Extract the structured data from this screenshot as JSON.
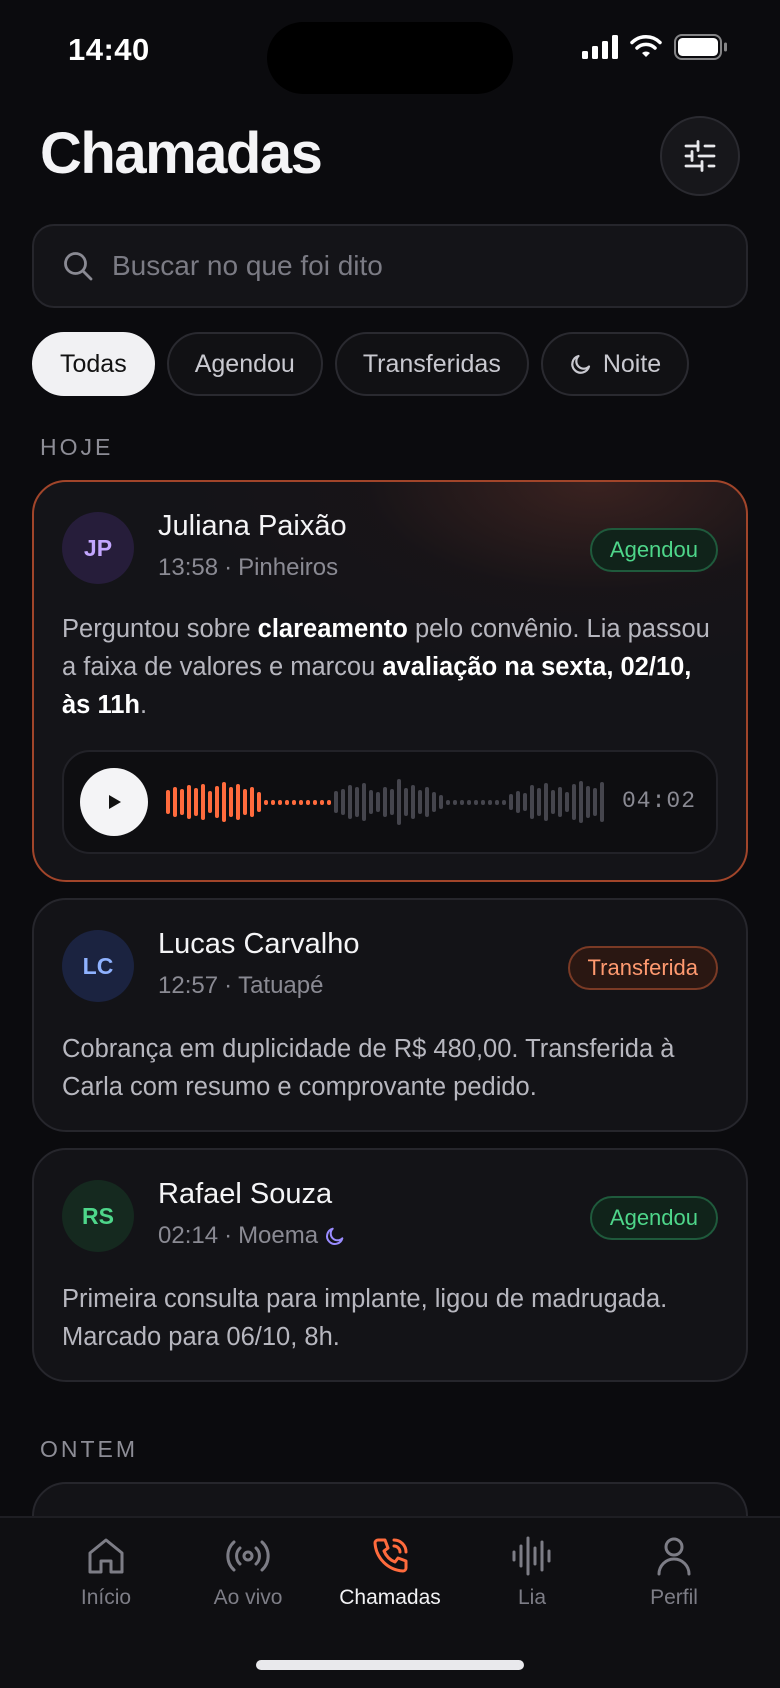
{
  "status": {
    "time": "14:40"
  },
  "header": {
    "title": "Chamadas",
    "filter_icon": "sliders-icon"
  },
  "search": {
    "placeholder": "Buscar no que foi dito",
    "value": ""
  },
  "chips": [
    {
      "label": "Todas",
      "active": true
    },
    {
      "label": "Agendou",
      "active": false
    },
    {
      "label": "Transferidas",
      "active": false
    },
    {
      "label": "Noite",
      "icon": "moon-icon",
      "active": false
    }
  ],
  "sections": {
    "today": "HOJE",
    "yesterday": "ONTEM"
  },
  "calls": [
    {
      "initials": "JP",
      "name": "Juliana Paixão",
      "time": "13:58",
      "place": "Pinheiros",
      "badge": "Agendou",
      "badge_color": "#4ed68a",
      "summary": {
        "t1": "Perguntou sobre ",
        "b1": "clareamento",
        "t2": " pelo convênio. Lia passou a faixa de valores e marcou ",
        "b2": "avaliação na sexta, 02/10, às 11h",
        "t3": "."
      },
      "audio": {
        "duration": "04:02",
        "played_fraction": 0.27,
        "accent": "#ff6b3d"
      }
    },
    {
      "initials": "LC",
      "name": "Lucas Carvalho",
      "time": "12:57",
      "place": "Tatuapé",
      "badge": "Transferida",
      "badge_color": "#ff9a70",
      "summary": "Cobrança em duplicidade de R$ 480,00. Transferida à Carla com resumo e comprovante pedido."
    },
    {
      "initials": "RS",
      "name": "Rafael Souza",
      "time": "02:14",
      "place": "Moema",
      "night": true,
      "badge": "Agendou",
      "badge_color": "#4ed68a",
      "summary": "Primeira consulta para implante, ligou de madrugada. Marcado para 06/10, 8h."
    }
  ],
  "tabs": [
    {
      "label": "Início",
      "icon": "home-icon",
      "active": false
    },
    {
      "label": "Ao vivo",
      "icon": "broadcast-icon",
      "active": false
    },
    {
      "label": "Chamadas",
      "icon": "phone-call-icon",
      "active": true
    },
    {
      "label": "Lia",
      "icon": "waveform-icon",
      "active": false
    },
    {
      "label": "Perfil",
      "icon": "user-icon",
      "active": false
    }
  ],
  "colors": {
    "accent": "#ff6b3d",
    "bg": "#0b0b0e",
    "green": "#4ed68a"
  }
}
